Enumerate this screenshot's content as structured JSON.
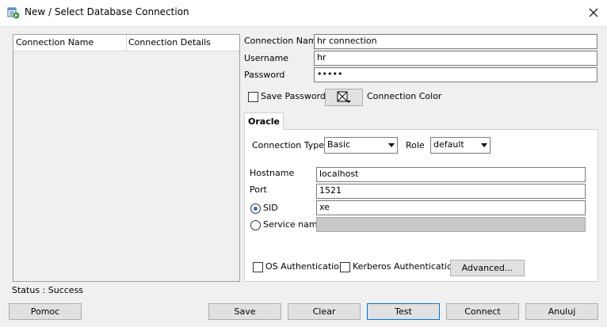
{
  "window": {
    "title": "New / Select Database Connection",
    "app_icon": "database-connection-icon",
    "close_icon": "close-icon"
  },
  "connection_list": {
    "columns": [
      "Connection Name",
      "Connection Details"
    ],
    "rows": []
  },
  "form": {
    "connection_name_label": "Connection Name",
    "connection_name_value": "hr connection",
    "username_label": "Username",
    "username_value": "hr",
    "password_label": "Password",
    "password_value": "•••••",
    "save_password_label": "Save Password",
    "save_password_checked": false,
    "connection_color_label": "Connection Color",
    "connection_color_icon": "no-color-swatch-icon"
  },
  "tabs": [
    {
      "label": "Oracle",
      "selected": true
    }
  ],
  "oracle": {
    "connection_type_label": "Connection Type",
    "connection_type_value": "Basic",
    "role_label": "Role",
    "role_value": "default",
    "hostname_label": "Hostname",
    "hostname_value": "localhost",
    "port_label": "Port",
    "port_value": "1521",
    "sid_label": "SID",
    "sid_value": "xe",
    "sid_selected": true,
    "service_name_label": "Service name",
    "service_name_value": "",
    "service_name_selected": false,
    "os_auth_label": "OS Authentication",
    "kerberos_auth_label": "Kerberos Authentication",
    "advanced_label": "Advanced..."
  },
  "status": {
    "text": "Status : Success"
  },
  "buttons": {
    "help": "Pomoc",
    "save": "Save",
    "clear": "Clear",
    "test": "Test",
    "connect": "Connect",
    "cancel": "Anuluj"
  },
  "colors": {
    "accent": "#0078d7",
    "radio_selected": "#2a6fd6",
    "disabled_field": "#c8c8c8"
  }
}
